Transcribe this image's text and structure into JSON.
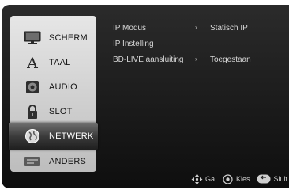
{
  "sidebar": {
    "items": [
      {
        "label": "SCHERM",
        "icon": "monitor-icon",
        "selected": false
      },
      {
        "label": "TAAL",
        "icon": "language-icon",
        "selected": false
      },
      {
        "label": "AUDIO",
        "icon": "speaker-icon",
        "selected": false
      },
      {
        "label": "SLOT",
        "icon": "lock-icon",
        "selected": false
      },
      {
        "label": "NETWERK",
        "icon": "network-globe-icon",
        "selected": true
      },
      {
        "label": "ANDERS",
        "icon": "other-icon",
        "selected": false
      }
    ]
  },
  "settings": {
    "rows": [
      {
        "label": "IP Modus",
        "arrow": "›",
        "value": "Statisch IP"
      },
      {
        "label": "IP Instelling",
        "arrow": "",
        "value": ""
      },
      {
        "label": "BD-LIVE aansluiting",
        "arrow": "›",
        "value": "Toegestaan"
      }
    ]
  },
  "footer": {
    "go_label": "Ga",
    "select_label": "Kies",
    "close_label": "Sluit"
  },
  "colors": {
    "panel_dark": "#111111",
    "sidebar_light": "#d6d6d6",
    "selected_dark": "#2e2e2e",
    "text_light": "#d8d8d8"
  }
}
